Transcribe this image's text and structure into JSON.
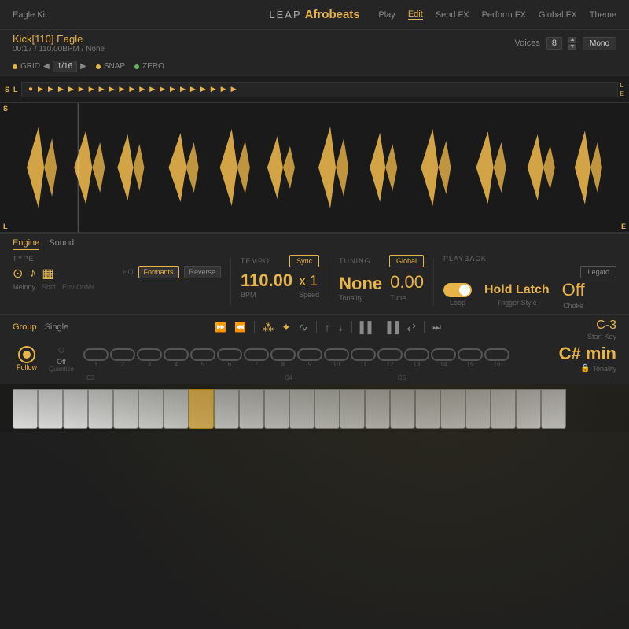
{
  "header": {
    "kit_name": "Eagle Kit",
    "leap_label": "LEAP",
    "product_name": "Afrobeats",
    "nav": [
      "Play",
      "Edit",
      "Send FX",
      "Perform FX",
      "Global FX",
      "Theme"
    ],
    "active_nav": "Edit"
  },
  "track": {
    "name": "Kick[110] Eagle",
    "meta": "00:17 / 110.00BPM / None",
    "voices_label": "Voices",
    "voices_value": "8",
    "mono_label": "Mono"
  },
  "grid": {
    "grid_label": "GRID",
    "grid_value": "1/16",
    "snap_label": "SNAP",
    "zero_label": "ZERO"
  },
  "engine": {
    "tabs": [
      "Engine",
      "Sound"
    ],
    "active_tab": "Engine",
    "type_label": "TYPE",
    "hq_label": "HQ",
    "formants_label": "Formants",
    "reverse_label": "Reverse",
    "shift_label": "Shift",
    "env_order_label": "Env Order",
    "melody_label": "Melody",
    "tempo_label": "TEMPO",
    "sync_label": "Sync",
    "bpm_value": "110.00",
    "bpm_sub": "BPM",
    "speed_value": "x 1",
    "speed_sub": "Speed",
    "tuning_label": "TUNING",
    "global_label": "Global",
    "tonality_value": "None",
    "tonality_sub": "Tonality",
    "tune_value": "0.00",
    "tune_sub": "Tune",
    "playback_label": "PLAYBACK",
    "loop_label": "Loop",
    "trigger_style_label": "Trigger Style",
    "hold_latch_value": "Hold Latch",
    "choke_label": "Choke",
    "choke_value": "Off",
    "legato_label": "Legato"
  },
  "group": {
    "tabs": [
      "Group",
      "Single"
    ],
    "active_tab": "Group",
    "toolbar_icons": [
      ">>",
      "<<",
      "grid1",
      "grid2",
      "wave",
      "up",
      "down",
      "bars1",
      "bars2",
      "arrows",
      ">>2"
    ],
    "start_key_label": "Start Key",
    "start_key_value": "C-3",
    "tonality_main": "C# min",
    "tonality_label": "Tonality"
  },
  "follow": {
    "follow_label": "Follow",
    "quantize_label": "Quantize",
    "quantize_value": "Off"
  },
  "pads": {
    "numbers": [
      "1",
      "2",
      "3",
      "4",
      "5",
      "6",
      "7",
      "8",
      "9",
      "10",
      "11",
      "12",
      "13",
      "14",
      "15",
      "16"
    ],
    "c3_label": "C3",
    "c4_label": "C4",
    "c5_label": "C5"
  },
  "colors": {
    "accent": "#e8b44a",
    "bg_dark": "#1a1a1a",
    "bg_mid": "#252525",
    "text_dim": "#666666",
    "text_mid": "#888888",
    "active_btn": "#e8b44a"
  }
}
